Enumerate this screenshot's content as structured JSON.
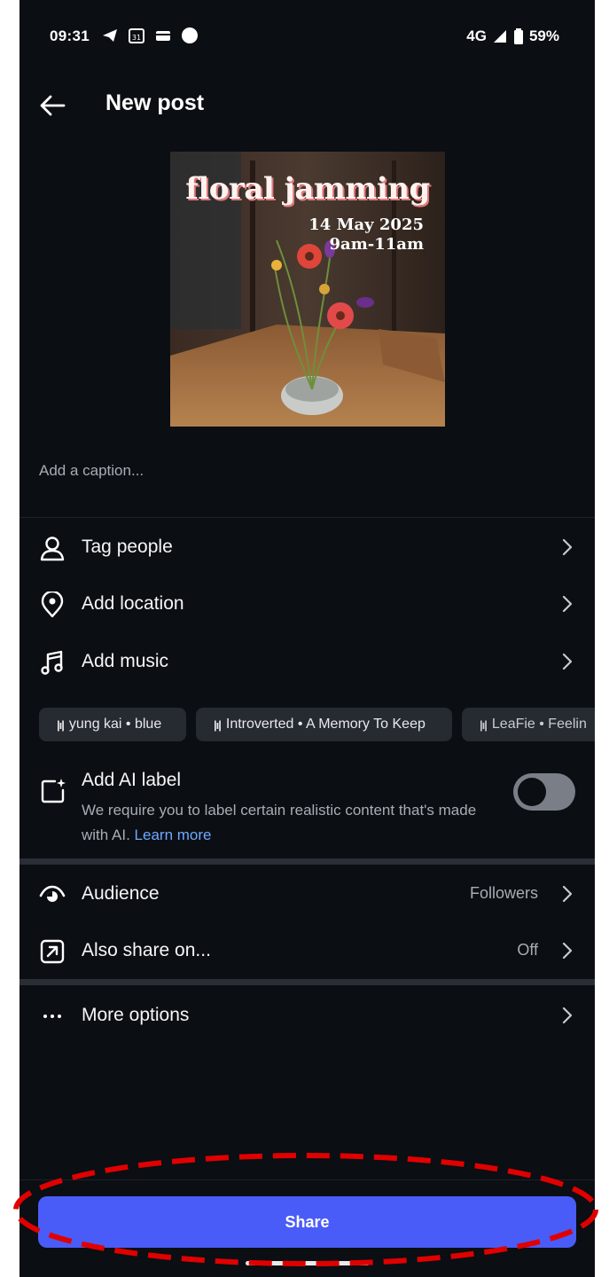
{
  "status_bar": {
    "time": "09:31",
    "network": "4G",
    "battery": "59%"
  },
  "header": {
    "title": "New post"
  },
  "preview": {
    "headline": "floral jamming",
    "date": "14 May 2025",
    "time": "9am-11am"
  },
  "caption": {
    "placeholder": "Add a caption..."
  },
  "options": {
    "tag_people": "Tag people",
    "add_location": "Add location",
    "add_music": "Add music"
  },
  "music_suggestions": [
    "yung kai • blue",
    "Introverted • A Memory To Keep",
    "LeaFie • Feelin"
  ],
  "ai_label": {
    "title": "Add AI label",
    "description": "We require you to label certain realistic content that's made with AI.",
    "link": "Learn more",
    "enabled": false
  },
  "audience": {
    "label": "Audience",
    "value": "Followers"
  },
  "also_share": {
    "label": "Also share on...",
    "value": "Off"
  },
  "more_options": {
    "label": "More options"
  },
  "share": {
    "label": "Share",
    "color": "#4a5cf7"
  },
  "colors": {
    "background": "#0b0e13",
    "secondary_text": "#a8adb5",
    "link": "#6ea9ff",
    "annotation": "#e00000"
  }
}
